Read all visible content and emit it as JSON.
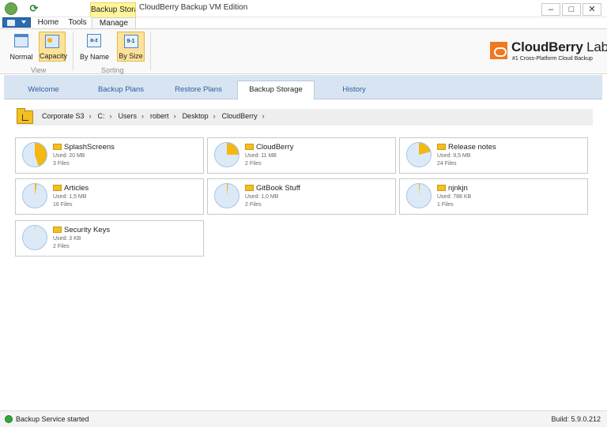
{
  "window": {
    "title": "CloudBerry Backup VM Edition",
    "context_tab": "Backup Storage"
  },
  "ribbon_tabs": [
    "Home",
    "Tools",
    "Manage"
  ],
  "ribbon": {
    "view": {
      "label": "View",
      "buttons": [
        {
          "label": "Normal",
          "icon": "normal-view-icon",
          "active": false
        },
        {
          "label": "Capacity",
          "icon": "capacity-view-icon",
          "active": true
        }
      ]
    },
    "sorting": {
      "label": "Sorting",
      "buttons": [
        {
          "label": "By Name",
          "icon": "sort-by-name-icon",
          "glyph": "a-z",
          "active": false
        },
        {
          "label": "By Size",
          "icon": "sort-by-size-icon",
          "glyph": "9-1",
          "active": true
        }
      ]
    }
  },
  "brand": {
    "name_bold": "CloudBerry",
    "name_light": " Lab",
    "tagline": "#1 Cross-Platform Cloud Backup",
    "accent": "#f07820"
  },
  "nav_tabs": [
    "Welcome",
    "Backup Plans",
    "Restore Plans",
    "Backup Storage",
    "History"
  ],
  "active_nav_tab": "Backup Storage",
  "breadcrumb": [
    "Corporate S3",
    "C:",
    "Users",
    "robert",
    "Desktop",
    "CloudBerry"
  ],
  "folders": [
    {
      "name": "SplashScreens",
      "used": "Used: 20 MB",
      "files": "3 Files",
      "share": 0.45
    },
    {
      "name": "CloudBerry",
      "used": "Used: 11 MB",
      "files": "2 Files",
      "share": 0.25
    },
    {
      "name": "Release notes",
      "used": "Used: 9,5 MB",
      "files": "24 Files",
      "share": 0.21
    },
    {
      "name": "Articles",
      "used": "Used: 1,5 MB",
      "files": "16 Files",
      "share": 0.03
    },
    {
      "name": "GitBook Stuff",
      "used": "Used: 1,0 MB",
      "files": "2 Files",
      "share": 0.02
    },
    {
      "name": "njnkjn",
      "used": "Used: 788 KB",
      "files": "1 Files",
      "share": 0.015
    },
    {
      "name": "Security Keys",
      "used": "Used: 3 KB",
      "files": "2 Files",
      "share": 0.003
    }
  ],
  "colors": {
    "used": "#f4b814",
    "free": "#dceaf8"
  },
  "status": {
    "text": "Backup Service started",
    "build": "Build: 5.9.0.212"
  }
}
